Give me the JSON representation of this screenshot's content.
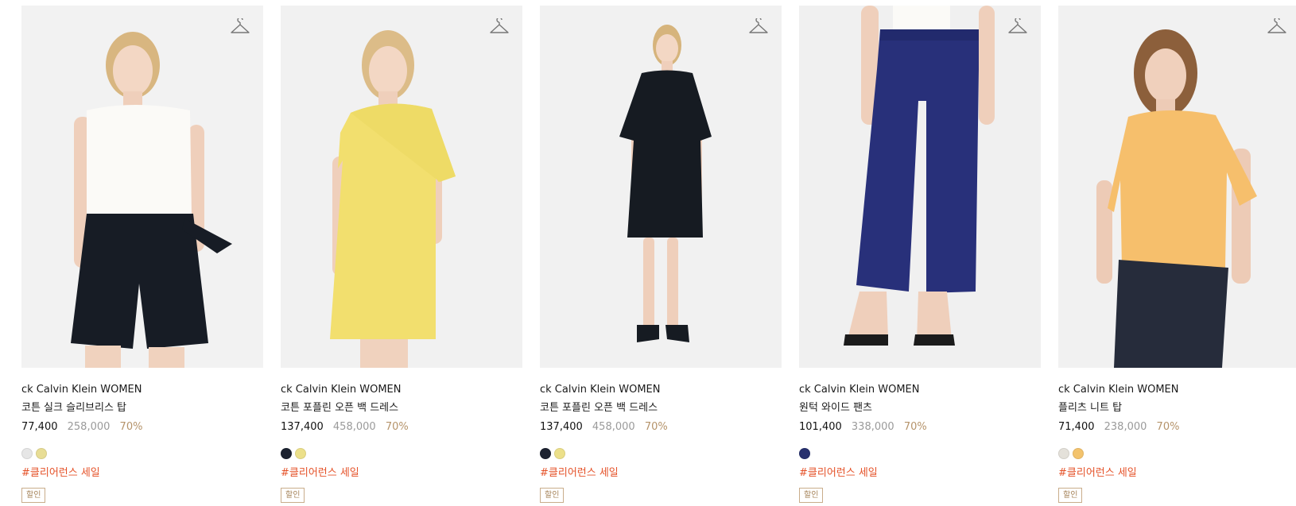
{
  "products": [
    {
      "brand": "ck Calvin Klein WOMEN",
      "name": "코튼 실크 슬리브리스 탑",
      "sale_price": "77,400",
      "original_price": "258,000",
      "discount": "70%",
      "swatches": [
        "#e6e6e6",
        "#e8dd95"
      ],
      "tag": "#클리어런스 세일",
      "badge": "할인",
      "image": "sleeveless-top-and-shorts-model"
    },
    {
      "brand": "ck Calvin Klein WOMEN",
      "name": "코튼 포플린 오픈 백 드레스",
      "sale_price": "137,400",
      "original_price": "458,000",
      "discount": "70%",
      "swatches": [
        "#1c2230",
        "#ece08a"
      ],
      "tag": "#클리어런스 세일",
      "badge": "할인",
      "image": "yellow-dress-model"
    },
    {
      "brand": "ck Calvin Klein WOMEN",
      "name": "코튼 포플린 오픈 백 드레스",
      "sale_price": "137,400",
      "original_price": "458,000",
      "discount": "70%",
      "swatches": [
        "#1c2230",
        "#ece08a"
      ],
      "tag": "#클리어런스 세일",
      "badge": "할인",
      "image": "black-dress-model"
    },
    {
      "brand": "ck Calvin Klein WOMEN",
      "name": "원턱 와이드 팬츠",
      "sale_price": "101,400",
      "original_price": "338,000",
      "discount": "70%",
      "swatches": [
        "#27306e"
      ],
      "tag": "#클리어런스 세일",
      "badge": "할인",
      "image": "navy-wide-pants-model"
    },
    {
      "brand": "ck Calvin Klein WOMEN",
      "name": "플리츠 니트 탑",
      "sale_price": "71,400",
      "original_price": "238,000",
      "discount": "70%",
      "swatches": [
        "#e4e1da",
        "#f3c36d"
      ],
      "tag": "#클리어런스 세일",
      "badge": "할인",
      "image": "orange-knit-top-model"
    }
  ],
  "icons": {
    "wishlist": "hanger-icon"
  },
  "colors": {
    "discount": "#b5936a",
    "tag": "#e5532a",
    "original_price": "#9a9a9a"
  }
}
